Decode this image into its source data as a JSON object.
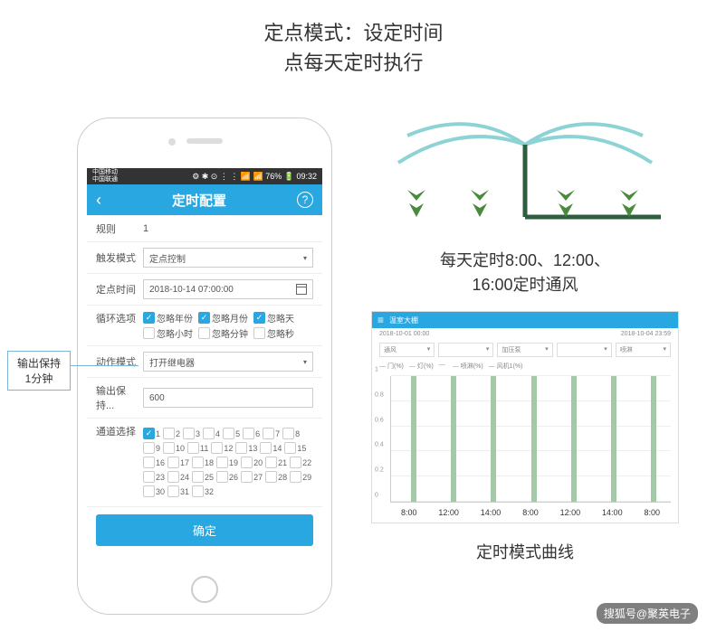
{
  "title_top": "定点模式：设定时间\n点每天定时执行",
  "phone": {
    "statusbar": {
      "carrier": "中国移动\n中国联通",
      "right": "⚙ ✱ ⊙ ⋮ ⋮ 📶 📶 76% 🔋 09:32"
    },
    "header": {
      "back": "‹",
      "title": "定时配置",
      "help": "?"
    },
    "rows": {
      "rule_label": "规则",
      "rule_value": "1",
      "trigger_label": "触发模式",
      "trigger_value": "定点控制",
      "time_label": "定点时间",
      "time_value": "2018-10-14 07:00:00",
      "loop_label": "循环选项",
      "loop_opts": [
        "忽略年份",
        "忽略月份",
        "忽略天",
        "忽略小时",
        "忽略分钟",
        "忽略秒"
      ],
      "loop_checked": [
        true,
        true,
        true,
        false,
        false,
        false
      ],
      "action_label": "动作模式",
      "action_value": "打开继电器",
      "hold_label": "输出保持...",
      "hold_value": "600",
      "channel_label": "通道选择"
    },
    "channel_count": 32,
    "channel_checked": [
      1
    ],
    "confirm": "确定"
  },
  "annotation": "输出保持\n1分钟",
  "right": {
    "caption": "每天定时8:00、12:00、\n16:00定时通风",
    "chart_caption": "定时模式曲线"
  },
  "chart_data": {
    "type": "bar",
    "header_title": "温室大棚",
    "date_start": "2018-10-01 00:00",
    "date_end": "2018-10-04 23:59",
    "filters": [
      "通风",
      "",
      "加压泵",
      "",
      "喷淋"
    ],
    "legends": [
      "门(%)",
      "灯(%)",
      "",
      "喷淋(%)",
      "风机1(%)"
    ],
    "ylim": [
      0,
      1.0
    ],
    "yticks": [
      0,
      0.2,
      0.4,
      0.6,
      0.8,
      1.0
    ],
    "x_labels": [
      "8:00",
      "12:00",
      "14:00",
      "8:00",
      "12:00",
      "14:00",
      "8:00"
    ],
    "values": [
      1,
      1,
      1,
      1,
      1,
      1,
      1
    ]
  },
  "watermark": "搜狐号@聚英电子"
}
